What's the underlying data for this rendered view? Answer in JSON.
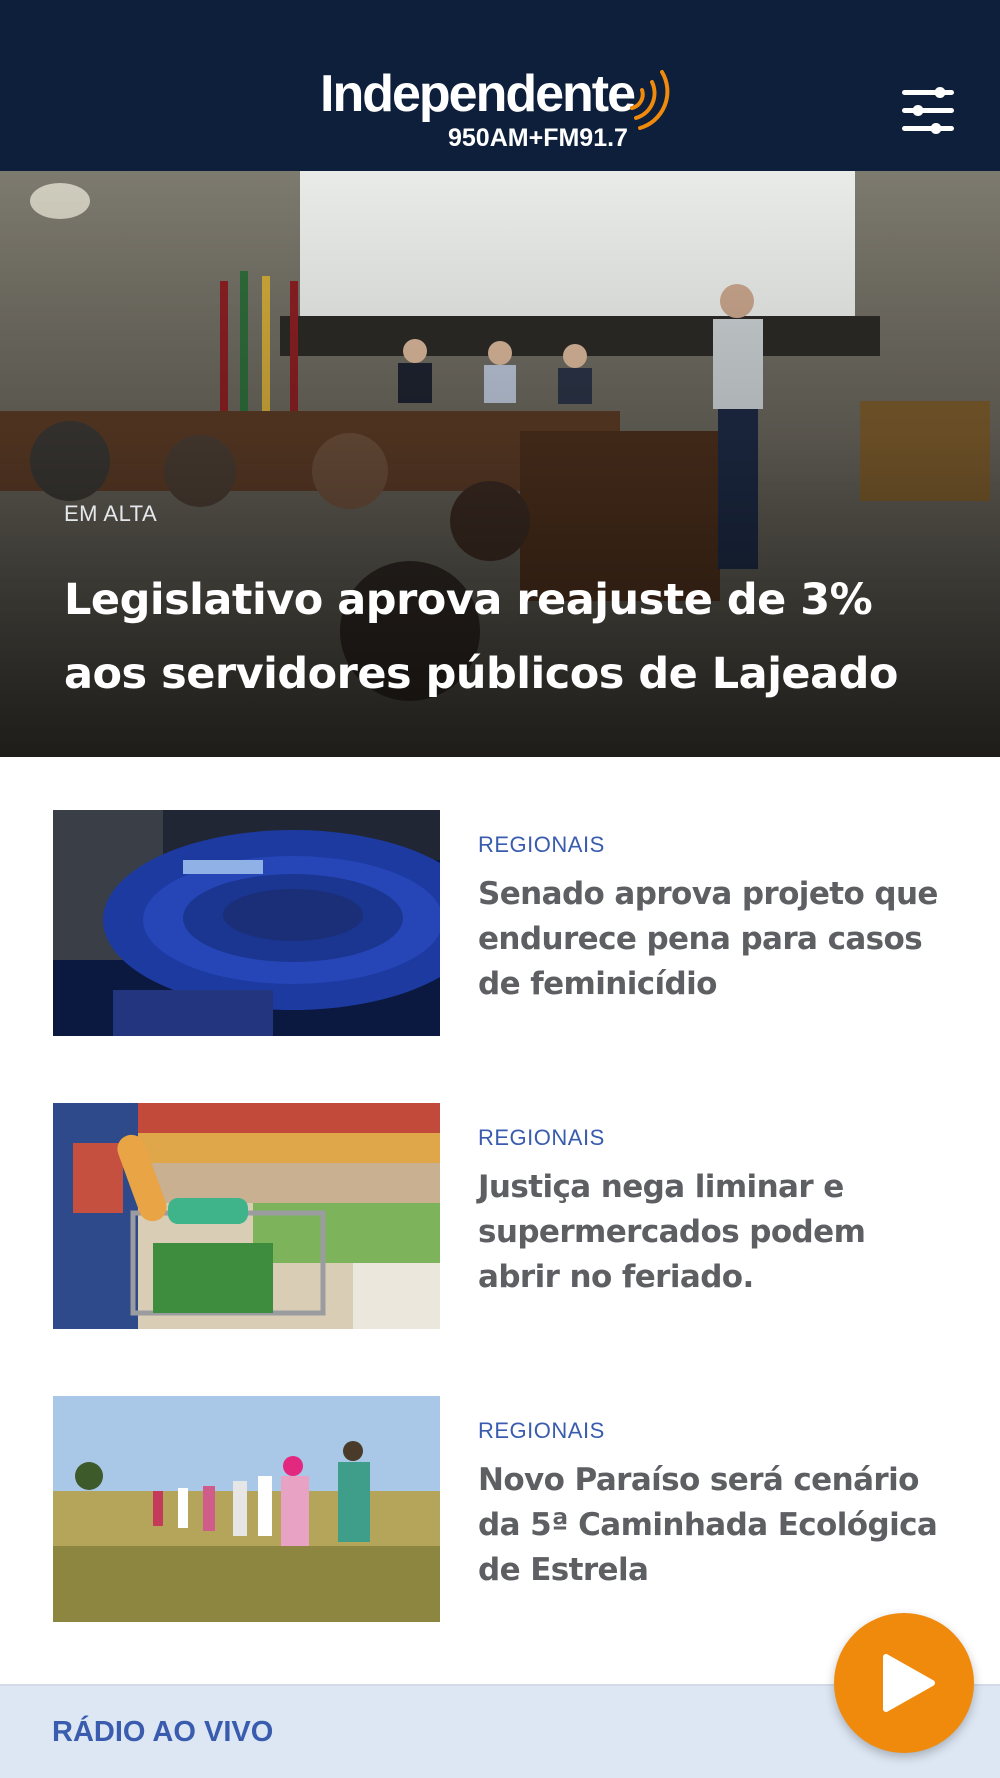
{
  "header": {
    "logo_name": "Independente",
    "logo_frequency": "950AM+FM91.7",
    "background_color": "#0d1f3a",
    "accent_color": "#ef8a0c",
    "menu_icon": "sliders-menu-icon"
  },
  "hero": {
    "tag": "EM ALTA",
    "title": "Legislativo aprova reajuste de 3% aos servidores públicos de Lajeado"
  },
  "news": [
    {
      "category": "REGIONAIS",
      "title": "Senado aprova projeto que endurece pena para casos de feminicídio"
    },
    {
      "category": "REGIONAIS",
      "title": "Justiça nega liminar e supermercados podem abrir no feriado."
    },
    {
      "category": "REGIONAIS",
      "title": "Novo Paraíso será cenário da 5ª Caminhada Ecológica de Estrela"
    }
  ],
  "radio": {
    "label": "RÁDIO AO VIVO",
    "play_icon": "play-icon",
    "category_color": "#3a5cae"
  }
}
